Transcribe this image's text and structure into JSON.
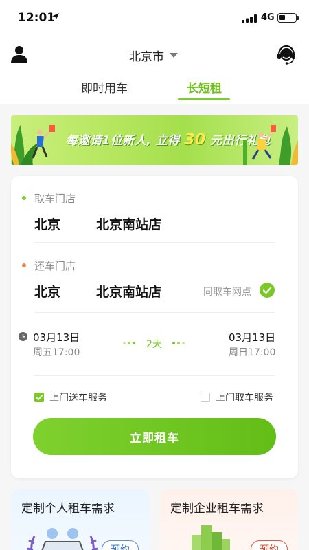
{
  "status_bar": {
    "time": "12:01",
    "network": "4G",
    "battery_level": 0.4
  },
  "header": {
    "city": "北京市",
    "tabs": [
      {
        "label": "即时用车",
        "active": false
      },
      {
        "label": "长短租",
        "active": true
      }
    ]
  },
  "banner": {
    "text_before": "每邀请1位新人, 立得",
    "amount": "30",
    "text_after": "元出行礼包"
  },
  "booking": {
    "pickup": {
      "label": "取车门店",
      "city": "北京",
      "store": "北京南站店"
    },
    "return": {
      "label": "还车门店",
      "city": "北京",
      "store": "北京南站店",
      "same_as_pickup_label": "同取车网点"
    },
    "start": {
      "date": "03月13日",
      "time": "周五17:00"
    },
    "end": {
      "date": "03月13日",
      "time": "周日17:00"
    },
    "duration": "2天",
    "options": [
      {
        "label": "上门送车服务",
        "checked": true
      },
      {
        "label": "上门取车服务",
        "checked": false
      }
    ],
    "submit_label": "立即租车"
  },
  "demand_cards": [
    {
      "title": "定制个人租车需求",
      "button": "预约"
    },
    {
      "title": "定制企业租车需求",
      "button": "预约"
    }
  ],
  "colors": {
    "accent": "#6ec21b",
    "pickup_dot": "#7cc829",
    "return_dot": "#f08a3c",
    "blue": "#3a6fc8",
    "red": "#d9452c"
  }
}
